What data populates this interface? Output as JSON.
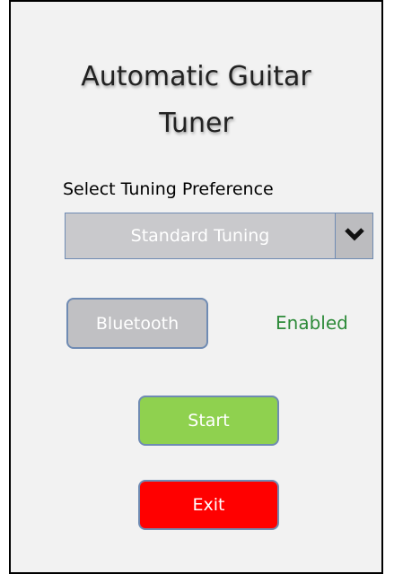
{
  "title": {
    "line1": "Automatic Guitar",
    "line2": "Tuner"
  },
  "tuning": {
    "label": "Select Tuning Preference",
    "selected": "Standard Tuning",
    "toggle_icon": "chevron-down-icon"
  },
  "bluetooth": {
    "button_label": "Bluetooth",
    "status": "Enabled",
    "status_color": "#2e8b3a"
  },
  "actions": {
    "start_label": "Start",
    "start_color": "#8fd14f",
    "exit_label": "Exit",
    "exit_color": "#ff0000"
  }
}
